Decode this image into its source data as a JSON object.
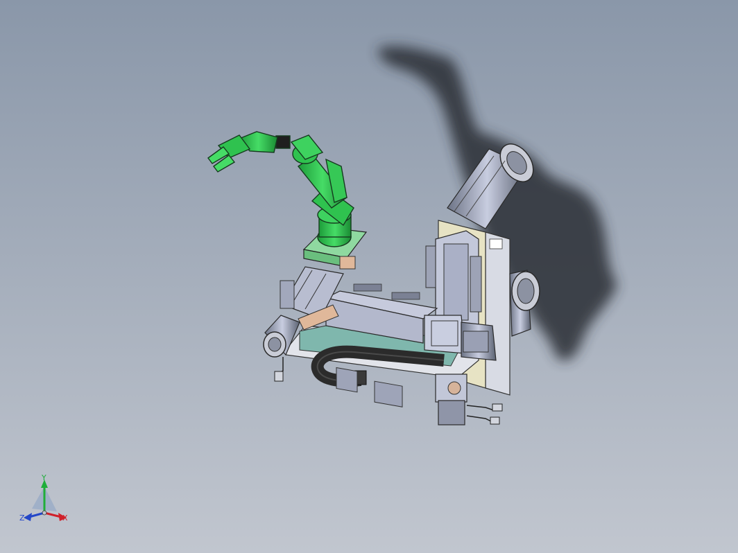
{
  "viewport": {
    "background_top": "#8a97a9",
    "background_bottom": "#c1c6cf"
  },
  "model": {
    "arm_color": "#2fc24f",
    "frame_color": "#b9bfd6",
    "motor_color": "#9aa2b8",
    "chain_color": "#2b2b2b",
    "base_plate_color": "#8fd9a0"
  },
  "triad": {
    "x_label": "X",
    "y_label": "Y",
    "z_label": "Z",
    "x_color": "#d0202a",
    "y_color": "#1fae3a",
    "z_color": "#2346c8"
  }
}
